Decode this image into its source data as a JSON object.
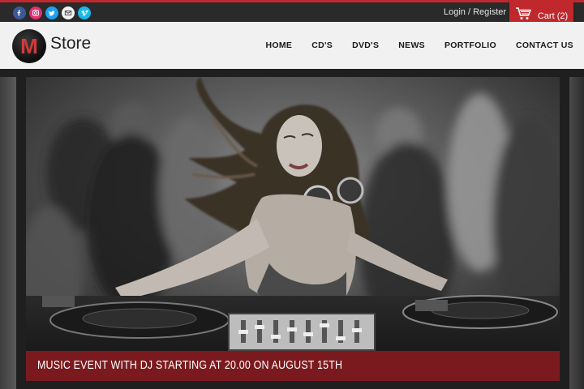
{
  "topbar": {
    "social": [
      {
        "icon": "facebook-icon",
        "color": "#3b5998"
      },
      {
        "icon": "instagram-icon",
        "color": "#e1306c"
      },
      {
        "icon": "twitter-icon",
        "color": "#1da1f2"
      },
      {
        "icon": "email-icon",
        "color": "#f2f2f2"
      },
      {
        "icon": "vimeo-icon",
        "color": "#1ab7ea"
      }
    ],
    "login_label": "Login / Register",
    "cart_label": "Cart (2)",
    "cart_icon": "shopping-cart-icon"
  },
  "header": {
    "logo_letter": "M",
    "logo_text": "Store",
    "nav": [
      "HOME",
      "CD'S",
      "DVD'S",
      "NEWS",
      "PORTFOLIO",
      "CONTACT US"
    ]
  },
  "slider": {
    "caption": "MUSIC EVENT WITH DJ STARTING AT 20.00 ON AUGUST 15TH"
  },
  "colors": {
    "accent": "#c0282d",
    "caption_bg": "#7a1a1e",
    "topbar_bg": "#2a2a2a",
    "header_bg": "#f1f1f1"
  }
}
